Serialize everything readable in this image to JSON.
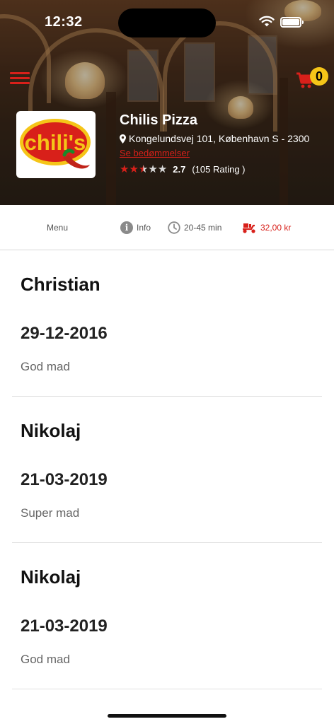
{
  "status_bar": {
    "time": "12:32"
  },
  "header": {
    "cart_count": "0",
    "logo_text": "chili's",
    "restaurant_name": "Chilis Pizza",
    "address": "Kongelundsvej 101, København S - 2300",
    "reviews_link": "Se bedømmelser",
    "rating_value": "2.7",
    "rating_count": "(105 Rating )",
    "rating_stars_filled": 2.5,
    "rating_stars_total": 5
  },
  "info_bar": {
    "menu_label": "Menu",
    "info_label": "Info",
    "delivery_time": "20-45 min",
    "delivery_fee": "32,00 kr"
  },
  "reviews": [
    {
      "name": "Christian",
      "date": "29-12-2016",
      "text": "God mad"
    },
    {
      "name": "Nikolaj",
      "date": "21-03-2019",
      "text": "Super mad"
    },
    {
      "name": "Nikolaj",
      "date": "21-03-2019",
      "text": "God mad"
    }
  ],
  "colors": {
    "accent": "#d8201a",
    "badge": "#f5c518",
    "text_muted": "#666666"
  },
  "icons": {
    "menu": "hamburger-icon",
    "cart": "cart-icon",
    "location": "map-pin-icon",
    "info": "info-icon",
    "clock": "clock-icon",
    "delivery": "delivery-scooter-icon"
  }
}
